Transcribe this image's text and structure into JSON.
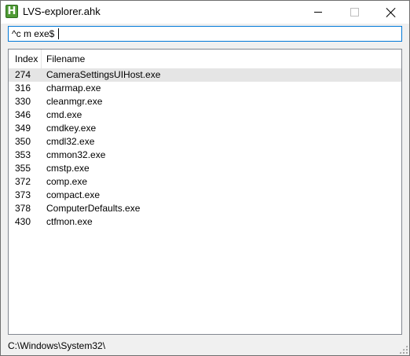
{
  "window": {
    "title": "LVS-explorer.ahk",
    "icon": "ahk-h-icon"
  },
  "search": {
    "value": "^c m exe$"
  },
  "list": {
    "columns": [
      "Index",
      "Filename"
    ],
    "rows": [
      {
        "index": "274",
        "filename": "CameraSettingsUIHost.exe",
        "selected": true
      },
      {
        "index": "316",
        "filename": "charmap.exe"
      },
      {
        "index": "330",
        "filename": "cleanmgr.exe"
      },
      {
        "index": "346",
        "filename": "cmd.exe"
      },
      {
        "index": "349",
        "filename": "cmdkey.exe"
      },
      {
        "index": "350",
        "filename": "cmdl32.exe"
      },
      {
        "index": "353",
        "filename": "cmmon32.exe"
      },
      {
        "index": "355",
        "filename": "cmstp.exe"
      },
      {
        "index": "372",
        "filename": "comp.exe"
      },
      {
        "index": "373",
        "filename": "compact.exe"
      },
      {
        "index": "378",
        "filename": "ComputerDefaults.exe"
      },
      {
        "index": "430",
        "filename": "ctfmon.exe"
      }
    ]
  },
  "status": {
    "path": "C:\\Windows\\System32\\"
  }
}
